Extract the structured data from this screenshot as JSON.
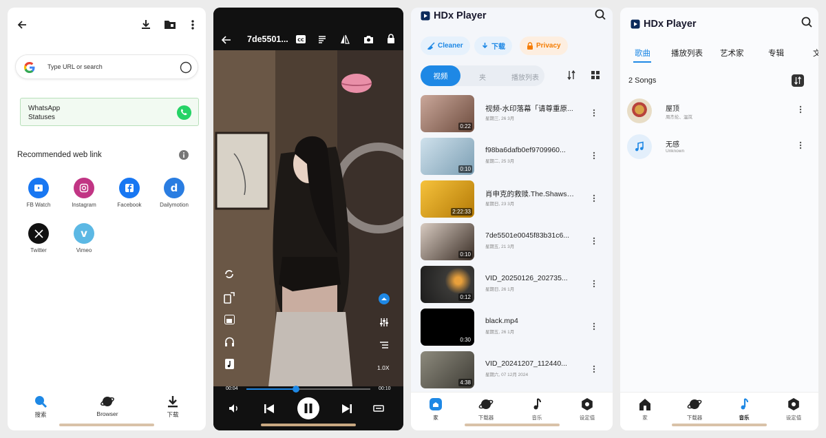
{
  "browser": {
    "search_placeholder": "Type URL or search",
    "whatsapp_label": "WhatsApp\nStatuses",
    "whatsapp_line1": "WhatsApp",
    "whatsapp_line2": "Statuses",
    "recommended_title": "Recommended web link",
    "links": [
      {
        "label": "FB Watch",
        "icon": "fb-watch-icon",
        "color": "#1877f2"
      },
      {
        "label": "Instagram",
        "icon": "instagram-icon",
        "color": "#c13584"
      },
      {
        "label": "Facebook",
        "icon": "facebook-icon",
        "color": "#1877f2"
      },
      {
        "label": "Dailymotion",
        "icon": "dailymotion-icon",
        "color": "#2a7de1"
      },
      {
        "label": "Twitter",
        "icon": "x-icon",
        "color": "#111111"
      },
      {
        "label": "Vimeo",
        "icon": "vimeo-icon",
        "color": "#5cb8e4"
      }
    ],
    "nav": [
      {
        "label": "搜索",
        "icon": "search-icon"
      },
      {
        "label": "Browser",
        "icon": "planet-icon"
      },
      {
        "label": "下载",
        "icon": "download-icon"
      }
    ]
  },
  "player": {
    "title": "7de5501...",
    "time_current": "00:04",
    "time_total": "00:10",
    "progress": 0.4,
    "speed": "1.0X"
  },
  "video_list": {
    "app_name": "HDx Player",
    "chips": [
      {
        "label": "Cleaner",
        "color": "#1e88e5",
        "bg": "#e6f1fc"
      },
      {
        "label": "下载",
        "color": "#1e88e5",
        "bg": "#e6f1fc"
      },
      {
        "label": "Privacy",
        "color": "#f57c00",
        "bg": "#fdeee0"
      }
    ],
    "segments": [
      "视频",
      "夹",
      "播放列表"
    ],
    "videos": [
      {
        "name": "视频-水印落幕「请尊重原...",
        "date": "星期三, 26 3月",
        "duration": "0:22"
      },
      {
        "name": "f98ba6dafb0ef9709960...",
        "date": "星期二, 25 3月",
        "duration": "0:10"
      },
      {
        "name": "肖申克的救赎.The.Shawsh...",
        "date": "星期日, 23 3月",
        "duration": "2:22:33"
      },
      {
        "name": "7de5501e0045f83b31c6...",
        "date": "星期五, 21 3月",
        "duration": "0:10"
      },
      {
        "name": "VID_20250126_202735...",
        "date": "星期日, 26 1月",
        "duration": "0:12"
      },
      {
        "name": "black.mp4",
        "date": "星期五, 26 1月",
        "duration": "0:30"
      },
      {
        "name": "VID_20241207_112440...",
        "date": "星期六, 07 12月 2024",
        "duration": "4:38"
      }
    ],
    "nav": [
      {
        "label": "家",
        "icon": "home-icon"
      },
      {
        "label": "下载器",
        "icon": "planet-icon"
      },
      {
        "label": "音乐",
        "icon": "music-note-icon"
      },
      {
        "label": "设定值",
        "icon": "settings-icon"
      }
    ]
  },
  "music": {
    "app_name": "HDx Player",
    "tabs": [
      "歌曲",
      "播放列表",
      "艺术家",
      "专辑",
      "文"
    ],
    "count": "2 Songs",
    "songs": [
      {
        "title": "屋顶",
        "artist": "周杰伦、温岚"
      },
      {
        "title": "无感",
        "artist": "Unknown"
      }
    ],
    "nav": [
      {
        "label": "家",
        "icon": "home-icon"
      },
      {
        "label": "下载器",
        "icon": "planet-icon"
      },
      {
        "label": "音乐",
        "icon": "music-note-icon"
      },
      {
        "label": "设定值",
        "icon": "settings-icon"
      }
    ]
  }
}
